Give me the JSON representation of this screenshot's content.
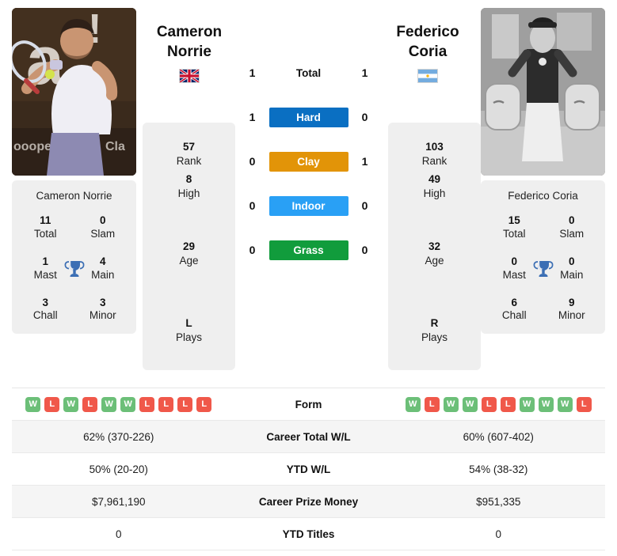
{
  "players": {
    "left": {
      "first_name": "Cameron",
      "last_name": "Norrie",
      "full_name": "Cameron Norrie",
      "flag": "gb-flag-icon",
      "photo": "player-photo-norrie",
      "rank": "57",
      "rank_label": "Rank",
      "high": "8",
      "high_label": "High",
      "age": "29",
      "age_label": "Age",
      "plays": "L",
      "plays_label": "Plays",
      "titles": {
        "total": "11",
        "total_label": "Total",
        "slam": "0",
        "slam_label": "Slam",
        "mast": "1",
        "mast_label": "Mast",
        "main": "4",
        "main_label": "Main",
        "chall": "3",
        "chall_label": "Chall",
        "minor": "3",
        "minor_label": "Minor"
      },
      "form": [
        "W",
        "L",
        "W",
        "L",
        "W",
        "W",
        "L",
        "L",
        "L",
        "L"
      ],
      "career_wl": "62% (370-226)",
      "ytd_wl": "50% (20-20)",
      "prize_money": "$7,961,190",
      "ytd_titles": "0"
    },
    "right": {
      "first_name": "Federico",
      "last_name": "Coria",
      "full_name": "Federico Coria",
      "flag": "ar-flag-icon",
      "photo": "player-photo-coria",
      "rank": "103",
      "rank_label": "Rank",
      "high": "49",
      "high_label": "High",
      "age": "32",
      "age_label": "Age",
      "plays": "R",
      "plays_label": "Plays",
      "titles": {
        "total": "15",
        "total_label": "Total",
        "slam": "0",
        "slam_label": "Slam",
        "mast": "0",
        "mast_label": "Mast",
        "main": "0",
        "main_label": "Main",
        "chall": "6",
        "chall_label": "Chall",
        "minor": "9",
        "minor_label": "Minor"
      },
      "form": [
        "W",
        "L",
        "W",
        "W",
        "L",
        "L",
        "W",
        "W",
        "W",
        "L"
      ],
      "career_wl": "60% (607-402)",
      "ytd_wl": "54% (38-32)",
      "prize_money": "$951,335",
      "ytd_titles": "0"
    }
  },
  "h2h": {
    "rows": [
      {
        "label": "Total",
        "left": "1",
        "right": "1",
        "color": "",
        "plain": true
      },
      {
        "label": "Hard",
        "left": "1",
        "right": "0",
        "color": "#0a6fc2",
        "plain": false
      },
      {
        "label": "Clay",
        "left": "0",
        "right": "1",
        "color": "#e29408",
        "plain": false
      },
      {
        "label": "Indoor",
        "left": "0",
        "right": "0",
        "color": "#29a0f5",
        "plain": false
      },
      {
        "label": "Grass",
        "left": "0",
        "right": "0",
        "color": "#119c3c",
        "plain": false
      }
    ]
  },
  "table": {
    "rows": [
      {
        "label": "Form",
        "left": "",
        "right": "",
        "type": "form"
      },
      {
        "label": "Career Total W/L",
        "left": "62% (370-226)",
        "right": "60% (607-402)",
        "type": "text"
      },
      {
        "label": "YTD W/L",
        "left": "50% (20-20)",
        "right": "54% (38-32)",
        "type": "text"
      },
      {
        "label": "Career Prize Money",
        "left": "$7,961,190",
        "right": "$951,335",
        "type": "text"
      },
      {
        "label": "YTD Titles",
        "left": "0",
        "right": "0",
        "type": "text"
      }
    ]
  },
  "colors": {
    "win": "#6cbf78",
    "loss": "#f0584a",
    "trophy": "#3b6eb4",
    "card_bg": "#efefef",
    "row_alt": "#f5f5f5"
  }
}
